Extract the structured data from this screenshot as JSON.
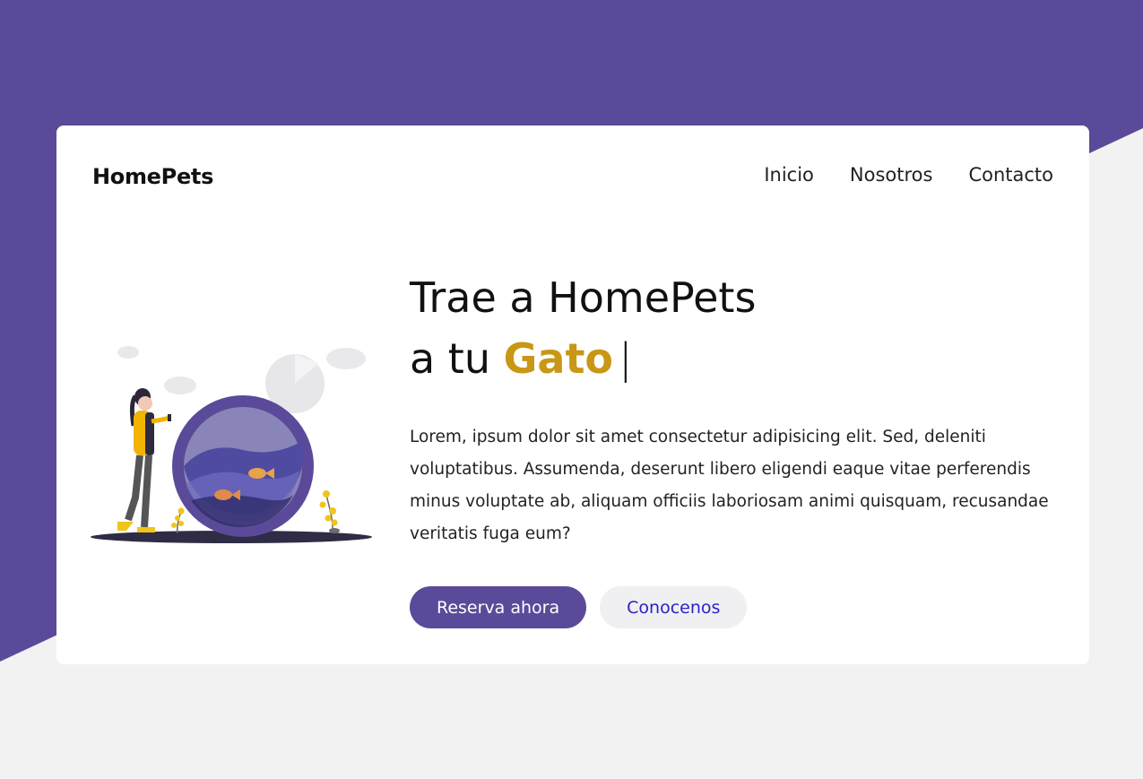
{
  "brand": "HomePets",
  "nav": [
    {
      "label": "Inicio"
    },
    {
      "label": "Nosotros"
    },
    {
      "label": "Contacto"
    }
  ],
  "hero": {
    "title_line1": "Trae a HomePets",
    "title_line2_prefix": "a tu",
    "title_accent": "Gato",
    "cursor": "|",
    "text": "Lorem, ipsum dolor sit amet consectetur adipisicing elit. Sed, deleniti voluptatibus. Assumenda, deserunt libero eligendi eaque vitae perferendis minus voluptate ab, aliquam officiis laboriosam animi quisquam, recusandae veritatis fuga eum?",
    "primary_button": "Reserva ahora",
    "secondary_button": "Conocenos"
  },
  "colors": {
    "primary": "#5b4a99",
    "accent": "#c99716",
    "background": "#f2f2f2",
    "card": "#ffffff",
    "secondary_button_bg": "#f0eff2",
    "secondary_button_text": "#2a22c7"
  },
  "illustration": "woman-with-fishbowl-illustration"
}
